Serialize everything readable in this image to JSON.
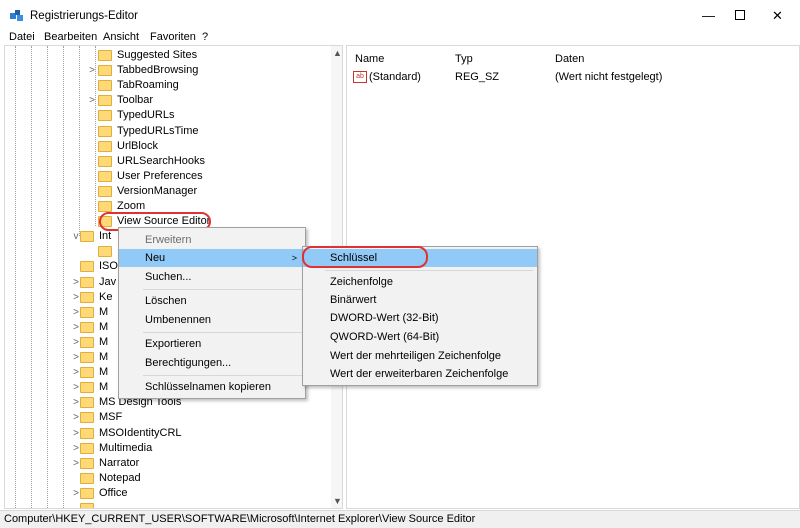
{
  "window": {
    "title": "Registrierungs-Editor",
    "minimize": "—",
    "close": "✕"
  },
  "menubar": [
    "Datei",
    "Bearbeiten",
    "Ansicht",
    "Favoriten",
    "?"
  ],
  "tree": {
    "items": [
      {
        "label": "Suggested Sites",
        "expander": ""
      },
      {
        "label": "TabbedBrowsing",
        "expander": ">"
      },
      {
        "label": "TabRoaming",
        "expander": ""
      },
      {
        "label": "Toolbar",
        "expander": ">"
      },
      {
        "label": "TypedURLs",
        "expander": ""
      },
      {
        "label": "TypedURLsTime",
        "expander": ""
      },
      {
        "label": "UrlBlock",
        "expander": ""
      },
      {
        "label": "URLSearchHooks",
        "expander": ""
      },
      {
        "label": "User Preferences",
        "expander": ""
      },
      {
        "label": "VersionManager",
        "expander": ""
      },
      {
        "label": "Zoom",
        "expander": ""
      },
      {
        "label": "View Source Editor",
        "expander": ""
      },
      {
        "label": "Int",
        "expander": "v"
      },
      {
        "label": "",
        "expander": ""
      },
      {
        "label": "ISO",
        "expander": ""
      },
      {
        "label": "Jav",
        "expander": ">"
      },
      {
        "label": "Ke",
        "expander": ">"
      },
      {
        "label": "M",
        "expander": ">"
      },
      {
        "label": "M",
        "expander": ">"
      },
      {
        "label": "M",
        "expander": ">"
      },
      {
        "label": "M",
        "expander": ">"
      },
      {
        "label": "M",
        "expander": ">"
      },
      {
        "label": "M",
        "expander": ">"
      },
      {
        "label": "MS Design Tools",
        "expander": ">"
      },
      {
        "label": "MSF",
        "expander": ">"
      },
      {
        "label": "MSOIdentityCRL",
        "expander": ">"
      },
      {
        "label": "Multimedia",
        "expander": ">"
      },
      {
        "label": "Narrator",
        "expander": ">"
      },
      {
        "label": "Notepad",
        "expander": ""
      },
      {
        "label": "Office",
        "expander": ">"
      },
      {
        "label": "",
        "expander": ""
      }
    ]
  },
  "list": {
    "headers": {
      "name": "Name",
      "type": "Typ",
      "data": "Daten"
    },
    "rows": [
      {
        "icon": "ab",
        "name": "(Standard)",
        "type": "REG_SZ",
        "data": "(Wert nicht festgelegt)"
      }
    ]
  },
  "context_menu": {
    "items": [
      "Erweitern",
      "Neu",
      "Suchen...",
      "Löschen",
      "Umbenennen",
      "Exportieren",
      "Berechtigungen...",
      "Schlüsselnamen kopieren"
    ],
    "submenu_arrow": ">"
  },
  "submenu": {
    "items": [
      "Schlüssel",
      "Zeichenfolge",
      "Binärwert",
      "DWORD-Wert (32-Bit)",
      "QWORD-Wert (64-Bit)",
      "Wert der mehrteiligen Zeichenfolge",
      "Wert der erweiterbaren Zeichenfolge"
    ]
  },
  "statusbar": {
    "path": "Computer\\HKEY_CURRENT_USER\\SOFTWARE\\Microsoft\\Internet Explorer\\View Source Editor"
  },
  "colors": {
    "highlight": "#91c9f7",
    "annotation": "#e03232",
    "folder": "#ffd976"
  }
}
